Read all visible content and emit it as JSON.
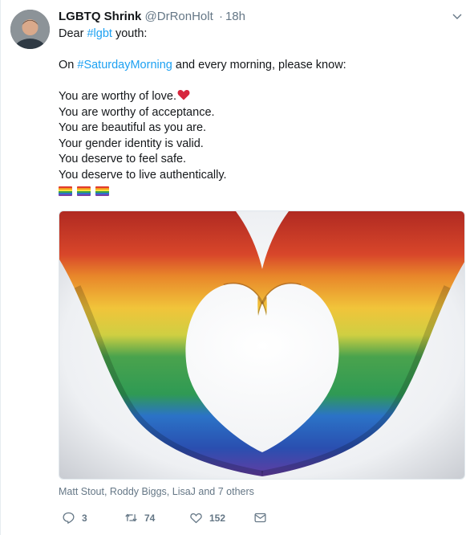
{
  "tweet": {
    "display_name": "LGBTQ Shrink",
    "handle": "@DrRonHolt",
    "separator": "·",
    "time": "18h",
    "lines": {
      "l1_prefix": "Dear ",
      "l1_hashtag": "#lgbt",
      "l1_suffix": " youth:",
      "l2_prefix": "On ",
      "l2_hashtag": "#SaturdayMorning",
      "l2_suffix": " and every morning, please know:",
      "l3": "You are worthy of love.",
      "l4": "You are worthy of acceptance.",
      "l5": "You are beautiful as you are.",
      "l6": "Your gender identity is valid.",
      "l7": "You deserve to feel safe.",
      "l8": "You deserve to live authentically."
    },
    "emoji": {
      "heart": "red-heart-icon",
      "flags": [
        "rainbow-flag-icon",
        "rainbow-flag-icon",
        "rainbow-flag-icon"
      ]
    },
    "media": {
      "alt": "heart-hands-rainbow-image"
    },
    "tagged_people": "Matt Stout, Roddy Biggs, LisaJ and 7 others",
    "actions": {
      "reply_count": "3",
      "retweet_count": "74",
      "like_count": "152"
    }
  },
  "colors": {
    "link": "#1da1f2",
    "secondary_text": "#657786",
    "rainbow": [
      "#e23a2e",
      "#f39a1f",
      "#f7e23a",
      "#3ba34a",
      "#2f6fd1",
      "#7b3fa6"
    ]
  }
}
